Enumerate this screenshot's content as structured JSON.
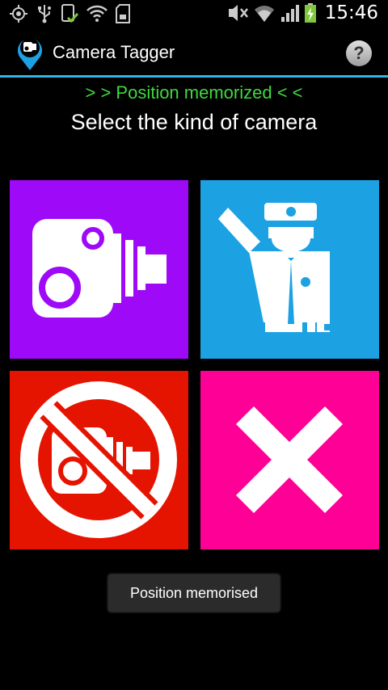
{
  "status_bar": {
    "time": "15:46",
    "left_icons": [
      "gps-icon",
      "usb-icon",
      "download-done-icon",
      "wifi-question-icon",
      "sd-card-icon"
    ],
    "right_icons": [
      "nfc-mute-icon",
      "wifi-signal-icon",
      "cell-signal-icon",
      "battery-charging-icon"
    ]
  },
  "action_bar": {
    "title": "Camera Tagger",
    "help_label": "?",
    "accent_color": "#33b5e5"
  },
  "status_message": "> > Position memorized < <",
  "heading": "Select the kind of camera",
  "tiles": [
    {
      "name": "fixed-speed-camera",
      "icon": "speed-camera-icon",
      "color": "#9e09f7"
    },
    {
      "name": "police-control",
      "icon": "police-officer-icon",
      "color": "#1ca1e2"
    },
    {
      "name": "no-camera",
      "icon": "no-camera-icon",
      "color": "#e51400"
    },
    {
      "name": "cancel",
      "icon": "close-icon",
      "color": "#ff0097"
    }
  ],
  "toast": "Position memorised"
}
